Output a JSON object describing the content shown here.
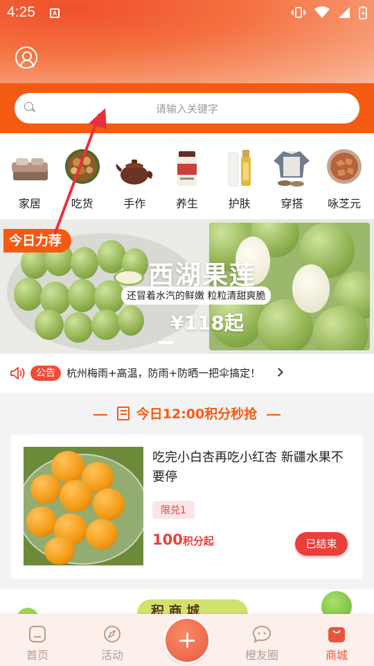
{
  "status": {
    "time": "4:25",
    "notification_letter": "A"
  },
  "search": {
    "placeholder": "请输入关键字"
  },
  "categories": [
    {
      "label": "家居",
      "icon": "bedding-icon"
    },
    {
      "label": "吃货",
      "icon": "nuts-icon"
    },
    {
      "label": "手作",
      "icon": "teapot-icon"
    },
    {
      "label": "养生",
      "icon": "supplement-jar-icon"
    },
    {
      "label": "护肤",
      "icon": "serum-bottle-icon"
    },
    {
      "label": "穿搭",
      "icon": "clothing-icon"
    },
    {
      "label": "咏芝元",
      "icon": "lingzhi-icon"
    }
  ],
  "banner": {
    "tag": "今日力荐",
    "title": "西湖果莲",
    "subtitle": "还冒着水汽的鲜嫩 粒粒清甜爽脆",
    "price": "¥118起"
  },
  "notice": {
    "badge": "公告",
    "text": "杭州梅雨+高温，防雨+防晒一把伞搞定！"
  },
  "flash_sale": {
    "title": "今日12:00积分秒抢",
    "product": {
      "title": "吃完小白杏再吃小红杏 新疆水果不要停",
      "limit": "限兑1",
      "points": "100",
      "points_unit": "积分起",
      "button": "已结束"
    }
  },
  "next_section": {
    "title_partial": "积  商 城"
  },
  "bottom_nav": [
    {
      "label": "首页",
      "icon": "home-icon"
    },
    {
      "label": "活动",
      "icon": "compass-icon"
    },
    {
      "label": "橙友圈",
      "icon": "chat-bubble-icon"
    },
    {
      "label": "商城",
      "icon": "shopping-bag-icon"
    }
  ],
  "colors": {
    "brand": "#f55a12",
    "accent_red": "#e8403a",
    "nav_inactive": "#b79b92"
  }
}
